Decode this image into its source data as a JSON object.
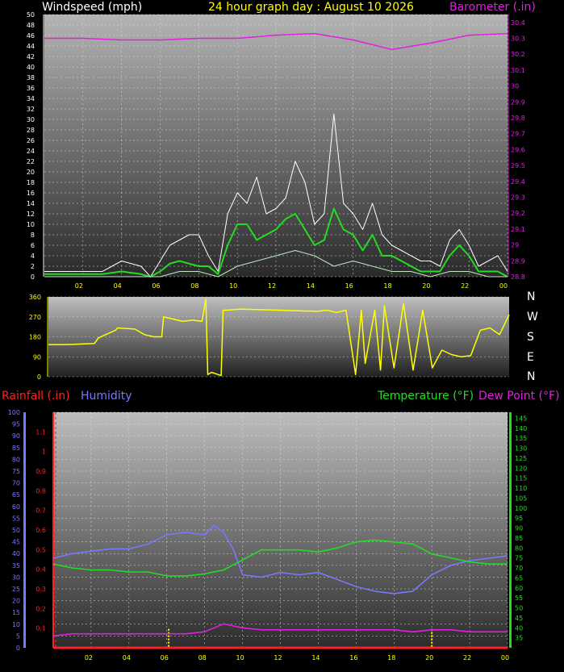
{
  "title": "24 hour graph day : August 10 2026",
  "colors": {
    "wind": "#ffffff",
    "gust_avg": "#22dd22",
    "wind_low": "#bfe8bf",
    "barometer": "#e020e0",
    "direction": "#ffff00",
    "rain": "#ff2020",
    "humidity": "#7878ff",
    "temperature": "#22dd22",
    "dewpoint": "#e020e0"
  },
  "labels": {
    "windspeed": "Windspeed (mph)",
    "barometer": "Barometer (.in)",
    "rainfall": "Rainfall (.in)",
    "humidity": "Humidity",
    "temperature": "Temperature (°F)",
    "dewpoint": "Dew Point (°F)"
  },
  "compass": [
    "N",
    "W",
    "S",
    "E",
    "N"
  ],
  "chart_data": [
    {
      "type": "line",
      "name": "wind-barometer",
      "x_ticks": [
        "02",
        "04",
        "06",
        "08",
        "10",
        "12",
        "14",
        "16",
        "18",
        "20",
        "22",
        "00"
      ],
      "ylabel": "Windspeed (mph)",
      "ylim": [
        0,
        50
      ],
      "y_ticks": [
        0,
        2,
        4,
        6,
        8,
        10,
        12,
        14,
        16,
        18,
        20,
        22,
        24,
        26,
        28,
        30,
        32,
        34,
        36,
        38,
        40,
        42,
        44,
        46,
        48,
        50
      ],
      "y2label": "Barometer (.in)",
      "y2lim": [
        28.8,
        30.45
      ],
      "y2_ticks": [
        "28.8",
        "28.9",
        "29",
        "29.1",
        "29.2",
        "29.3",
        "29.4",
        "29.5",
        "29.6",
        "29.7",
        "29.8",
        "29.9",
        "30",
        "30.1",
        "30.2",
        "30.3",
        "30.4"
      ],
      "series": [
        {
          "key": "wind",
          "x": [
            0,
            1,
            2,
            3,
            4,
            5,
            5.5,
            6,
            6.5,
            7,
            7.5,
            8,
            8.5,
            9,
            9.5,
            10,
            10.5,
            11,
            11.5,
            12,
            12.5,
            13,
            13.5,
            14,
            14.5,
            15,
            15.5,
            16,
            16.5,
            17,
            17.5,
            18,
            18.5,
            19,
            19.5,
            20,
            20.5,
            21,
            21.5,
            22,
            22.5,
            23,
            23.5,
            24
          ],
          "y": [
            1,
            1,
            1,
            1,
            3,
            2,
            0,
            3,
            6,
            7,
            8,
            8,
            4,
            1,
            12,
            16,
            14,
            19,
            12,
            13,
            15,
            22,
            18,
            10,
            12,
            31,
            14,
            12,
            9,
            14,
            8,
            6,
            5,
            4,
            3,
            3,
            2,
            7,
            9,
            6,
            2,
            3,
            4,
            1
          ]
        },
        {
          "key": "gust_avg",
          "x": [
            0,
            1,
            2,
            3,
            4,
            5,
            5.5,
            6,
            6.5,
            7,
            7.5,
            8,
            8.5,
            9,
            9.5,
            10,
            10.5,
            11,
            11.5,
            12,
            12.5,
            13,
            13.5,
            14,
            14.5,
            15,
            15.5,
            16,
            16.5,
            17,
            17.5,
            18,
            18.5,
            19,
            19.5,
            20,
            20.5,
            21,
            21.5,
            22,
            22.5,
            23,
            23.5,
            24
          ],
          "y": [
            0.5,
            0.5,
            0.5,
            0.5,
            1,
            0.5,
            0,
            1,
            2.5,
            3,
            2.5,
            2,
            2,
            0.5,
            6,
            10,
            10,
            7,
            8,
            9,
            11,
            12,
            9,
            6,
            7,
            13,
            9,
            8,
            5,
            8,
            4,
            4,
            3,
            2,
            1,
            1,
            1,
            4,
            6,
            4,
            1,
            1,
            1,
            0
          ]
        },
        {
          "key": "wind_low",
          "x": [
            0,
            1,
            2,
            3,
            4,
            5,
            6,
            7,
            8,
            9,
            10,
            11,
            12,
            13,
            14,
            15,
            16,
            17,
            18,
            19,
            20,
            21,
            22,
            23,
            24
          ],
          "y": [
            0,
            0,
            0,
            0,
            0,
            0,
            0,
            1,
            1,
            0,
            2,
            3,
            4,
            5,
            4,
            2,
            3,
            2,
            1,
            1,
            0,
            1,
            1,
            0,
            0
          ]
        },
        {
          "key": "barometer",
          "x": [
            0,
            2,
            4,
            6,
            8,
            10,
            12,
            14,
            16,
            18,
            20,
            22,
            24
          ],
          "y": [
            30.3,
            30.3,
            30.29,
            30.29,
            30.3,
            30.3,
            30.32,
            30.33,
            30.29,
            30.23,
            30.27,
            30.32,
            30.33
          ]
        }
      ]
    },
    {
      "type": "line",
      "name": "wind-direction",
      "ylim": [
        0,
        360
      ],
      "y_ticks": [
        0,
        90,
        180,
        270,
        360
      ],
      "series": [
        {
          "key": "direction",
          "x": [
            0,
            1,
            2.4,
            2.6,
            3.5,
            3.6,
            4.5,
            5,
            5.5,
            5.9,
            6,
            6.5,
            7,
            7.5,
            8,
            8.2,
            8.3,
            8.5,
            9,
            9.1,
            9.3,
            10,
            12,
            14,
            14.5,
            15,
            15.5,
            16,
            16.3,
            16.5,
            17,
            17.3,
            17.5,
            18,
            18.5,
            19,
            19.5,
            20,
            20.5,
            21,
            21.5,
            22,
            22.5,
            23,
            23.5,
            24
          ],
          "y": [
            145,
            145,
            150,
            175,
            210,
            220,
            215,
            190,
            180,
            180,
            270,
            260,
            250,
            255,
            250,
            350,
            10,
            20,
            5,
            300,
            300,
            305,
            300,
            295,
            300,
            290,
            300,
            10,
            300,
            60,
            300,
            30,
            320,
            40,
            330,
            30,
            300,
            40,
            120,
            100,
            90,
            95,
            210,
            220,
            190,
            280
          ]
        }
      ]
    },
    {
      "type": "line",
      "name": "rain-humidity-temperature",
      "x_ticks": [
        "02",
        "04",
        "06",
        "08",
        "10",
        "12",
        "14",
        "16",
        "18",
        "20",
        "22",
        "00"
      ],
      "humidity_ticks": [
        0,
        5,
        10,
        15,
        20,
        25,
        30,
        35,
        40,
        45,
        50,
        55,
        60,
        65,
        70,
        75,
        80,
        85,
        90,
        95,
        100
      ],
      "rain_ticks": [
        "0.1",
        "0.2",
        "0.3",
        "0.4",
        "0.5",
        "0.6",
        "0.7",
        "0.8",
        "0.9",
        "1",
        "1.1"
      ],
      "temp_ticks": [
        35,
        40,
        45,
        50,
        55,
        60,
        65,
        70,
        75,
        80,
        85,
        90,
        95,
        100,
        105,
        110,
        115,
        120,
        125,
        130,
        135,
        140,
        145
      ],
      "humidity_lim": [
        0,
        100
      ],
      "rain_lim": [
        0,
        1.2
      ],
      "temp_lim": [
        30,
        148
      ],
      "series": [
        {
          "key": "humidity",
          "x": [
            0,
            1,
            2,
            3,
            4,
            5,
            5.5,
            6,
            7,
            8,
            8.5,
            9,
            9.5,
            10,
            11,
            12,
            13,
            14,
            15,
            16,
            17,
            18,
            19,
            20,
            21,
            22,
            23,
            24
          ],
          "y": [
            38,
            40,
            41,
            42,
            42,
            44,
            46,
            48,
            49,
            48,
            52,
            49,
            42,
            31,
            30,
            32,
            31,
            32,
            29,
            26,
            24,
            23,
            24,
            31,
            35,
            37,
            38,
            39
          ]
        },
        {
          "key": "temperature",
          "x": [
            0,
            1,
            2,
            3,
            4,
            5,
            6,
            7,
            8,
            9,
            10,
            11,
            12,
            13,
            14,
            15,
            16,
            17,
            18,
            19,
            20,
            21,
            22,
            23,
            24
          ],
          "y": [
            72,
            70,
            69,
            69,
            68,
            68,
            66,
            66,
            67,
            69,
            74,
            79,
            79,
            79,
            78,
            80,
            83,
            84,
            83,
            82,
            77,
            75,
            73,
            72,
            72
          ]
        },
        {
          "key": "dewpoint",
          "x": [
            0,
            1,
            2,
            3,
            4,
            5,
            6,
            7,
            8,
            9,
            10,
            11,
            12,
            13,
            14,
            15,
            16,
            17,
            18,
            19,
            20,
            21,
            22,
            23,
            24
          ],
          "y": [
            36,
            37,
            37,
            37,
            37,
            37,
            37,
            37,
            38,
            42,
            40,
            39,
            39,
            39,
            39,
            39,
            39,
            39,
            39,
            38,
            39,
            39,
            38,
            38,
            38
          ]
        },
        {
          "key": "rain",
          "x": [
            0,
            24
          ],
          "y": [
            0,
            0
          ]
        }
      ],
      "markers_x": [
        6.1,
        20
      ]
    }
  ]
}
